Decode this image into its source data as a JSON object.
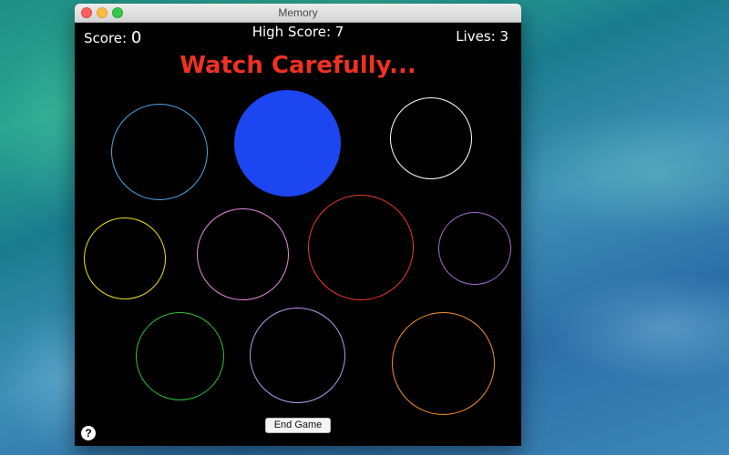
{
  "window": {
    "title": "Memory"
  },
  "hud": {
    "score_label": "Score:",
    "score_value": "0",
    "high_score": "High Score: 7",
    "lives": "Lives: 3"
  },
  "message": {
    "text": "Watch Carefully...",
    "color": "#ee3124"
  },
  "circles": [
    {
      "name": "circle-sky-blue",
      "color": "#4aa8e8",
      "lit": false
    },
    {
      "name": "circle-blue",
      "color": "#1b46f0",
      "lit": true
    },
    {
      "name": "circle-white",
      "color": "#ffffff",
      "lit": false
    },
    {
      "name": "circle-yellow",
      "color": "#f0e21c",
      "lit": false
    },
    {
      "name": "circle-pink",
      "color": "#e58be0",
      "lit": false
    },
    {
      "name": "circle-red",
      "color": "#f0392e",
      "lit": false
    },
    {
      "name": "circle-purple",
      "color": "#a46bd0",
      "lit": false
    },
    {
      "name": "circle-green",
      "color": "#30c23b",
      "lit": false
    },
    {
      "name": "circle-lavender",
      "color": "#b79bf0",
      "lit": false
    },
    {
      "name": "circle-orange",
      "color": "#f5902a",
      "lit": false
    }
  ],
  "controls": {
    "end_game_label": "End Game",
    "help_label": "?"
  }
}
